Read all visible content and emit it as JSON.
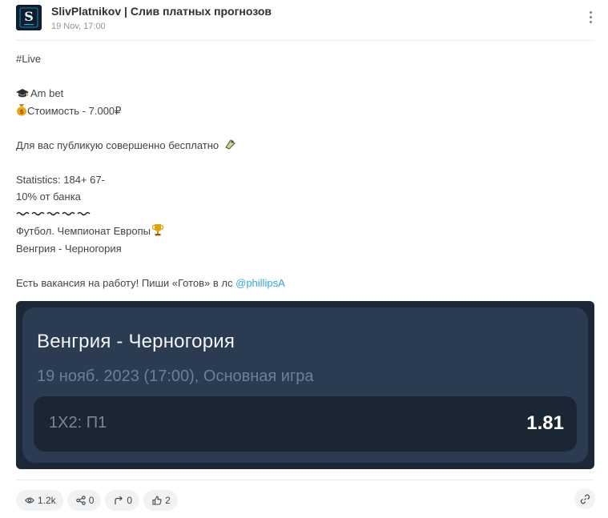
{
  "channel": {
    "name": "SlivPlatnikov | Слив платных прогнозов",
    "date": "19 Nov, 17:00",
    "avatar_letter": "S"
  },
  "post": {
    "hashtag": "#Live",
    "bookmaker": "Am bet",
    "price": "Стоимость - 7.000₽",
    "free_note": "Для вас публикую совершенно бесплатно",
    "statistics": "Statistics: 184+ 67-",
    "stake": "10% от банка",
    "tournament": "Футбол. Чемпионат Европы",
    "match": "Венгрия - Черногория",
    "vacancy": "Есть вакансия на работу! Пиши «Готов» в лс",
    "mention": "@phillipsA"
  },
  "icons": {
    "bookmaker": "graduation-cap-icon",
    "price": "money-bag-icon",
    "free_note": "pin-icon",
    "tournament": "trophy-icon",
    "wave_separator": "wavy-dash-icon"
  },
  "bet_card": {
    "title": "Венгрия - Черногория",
    "date": "19 нояб. 2023 (17:00), Основная игра",
    "market": "1X2: П1",
    "odds": "1.81"
  },
  "stats": {
    "views": "1.2k",
    "shares": "0",
    "forwards": "0",
    "reactions": "2"
  },
  "colors": {
    "accent_link": "#2fa7d9",
    "card_outer": "#1c2836",
    "card_inner": "#2b3b51",
    "odds_row": "#1b2634"
  }
}
